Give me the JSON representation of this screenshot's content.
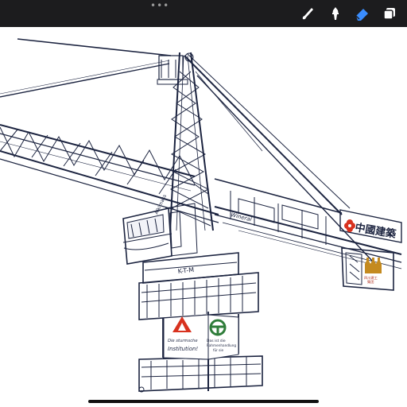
{
  "app": {
    "name": "Procreate",
    "accent_color": "#3a8dff",
    "toolbar_bg": "#1c1c1e"
  },
  "toolbar": {
    "grip_icon": "more-dots-icon",
    "tools": [
      {
        "name": "brush",
        "icon": "brush-icon",
        "active": false
      },
      {
        "name": "smudge",
        "icon": "smudge-icon",
        "active": false
      },
      {
        "name": "eraser",
        "icon": "eraser-icon",
        "active": true
      },
      {
        "name": "layers",
        "icon": "layers-icon",
        "active": false
      }
    ]
  },
  "drawing": {
    "subject": "tower crane line drawing",
    "cab_lettering": "Alkimass",
    "jib_lettering": "Wineral",
    "tower_lettering": "K-T-M",
    "banner_lettering": "中國建築",
    "sign_left_line1": "Die sturmsche",
    "sign_left_line2": "Institution!",
    "sign_right_line1": "Das ist die",
    "sign_right_line2": "Rahmenhandlung",
    "sign_right_line3": "für sie",
    "counterweight_label1": "四川建工",
    "counterweight_label2": "集团",
    "logo_red": "#d8321f",
    "logo_green": "#2f7d3a",
    "logo_gold": "#c48a1f",
    "ink_color": "#1c2440"
  }
}
